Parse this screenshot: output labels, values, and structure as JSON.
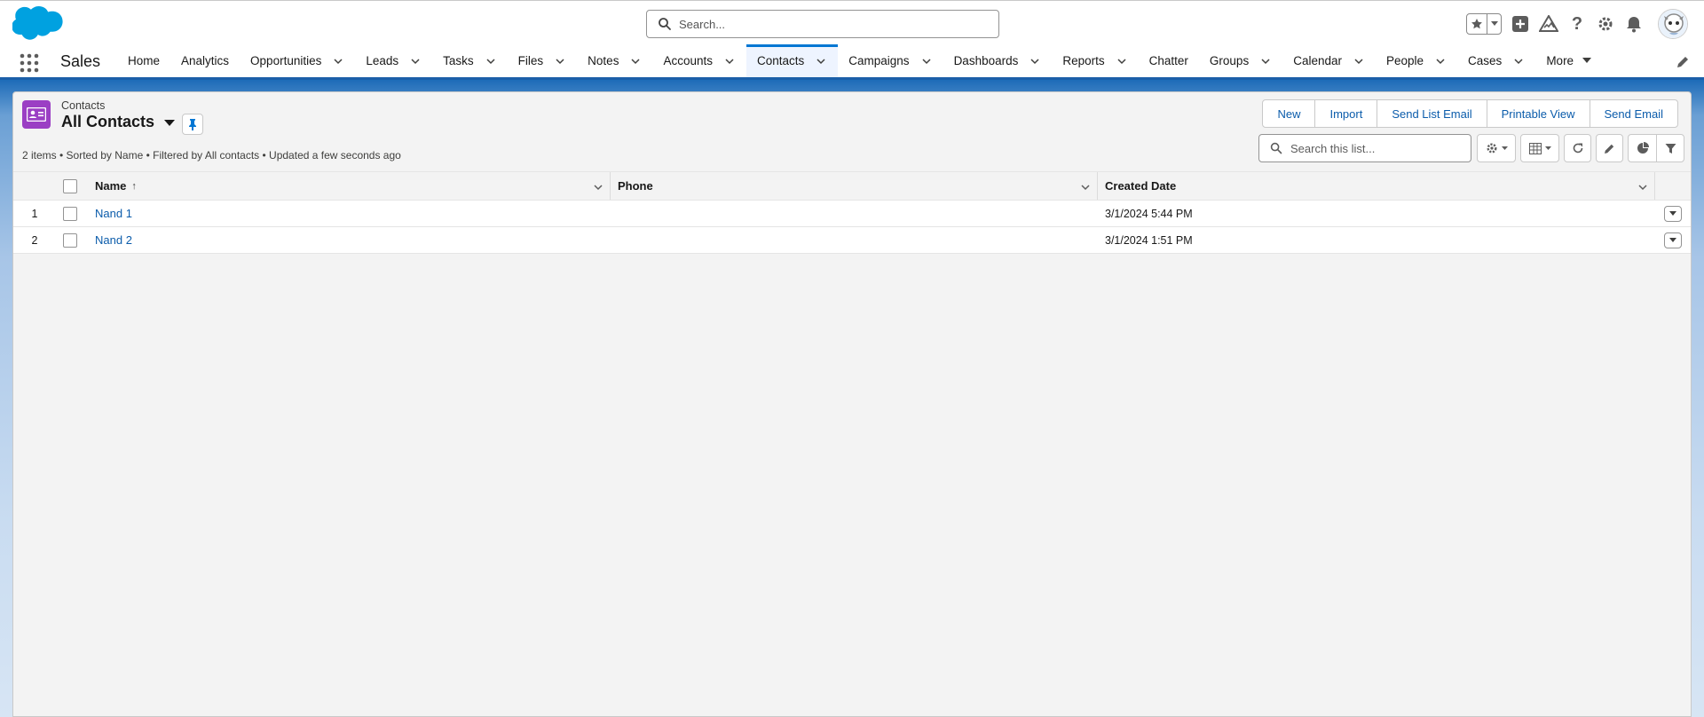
{
  "header": {
    "search_placeholder": "Search..."
  },
  "nav": {
    "app_name": "Sales",
    "tabs": [
      {
        "label": "Home",
        "dropdown": false
      },
      {
        "label": "Analytics",
        "dropdown": false
      },
      {
        "label": "Opportunities",
        "dropdown": true
      },
      {
        "label": "Leads",
        "dropdown": true
      },
      {
        "label": "Tasks",
        "dropdown": true
      },
      {
        "label": "Files",
        "dropdown": true
      },
      {
        "label": "Notes",
        "dropdown": true
      },
      {
        "label": "Accounts",
        "dropdown": true
      },
      {
        "label": "Contacts",
        "dropdown": true,
        "active": true
      },
      {
        "label": "Campaigns",
        "dropdown": true
      },
      {
        "label": "Dashboards",
        "dropdown": true
      },
      {
        "label": "Reports",
        "dropdown": true
      },
      {
        "label": "Chatter",
        "dropdown": false
      },
      {
        "label": "Groups",
        "dropdown": true
      },
      {
        "label": "Calendar",
        "dropdown": true
      },
      {
        "label": "People",
        "dropdown": true
      },
      {
        "label": "Cases",
        "dropdown": true
      }
    ],
    "more_label": "More"
  },
  "list": {
    "object_label": "Contacts",
    "view_name": "All Contacts",
    "status": "2 items • Sorted by Name • Filtered by All contacts • Updated a few seconds ago",
    "buttons": {
      "new": "New",
      "import": "Import",
      "send_list_email": "Send List Email",
      "printable_view": "Printable View",
      "send_email": "Send Email"
    },
    "search_placeholder": "Search this list...",
    "columns": {
      "name": "Name",
      "name_sort": "↑",
      "phone": "Phone",
      "created_date": "Created Date"
    },
    "rows": [
      {
        "num": "1",
        "name": "Nand 1",
        "phone": "",
        "created": "3/1/2024 5:44 PM"
      },
      {
        "num": "2",
        "name": "Nand 2",
        "phone": "",
        "created": "3/1/2024 1:51 PM"
      }
    ]
  },
  "colors": {
    "brand_blue": "#0176d3",
    "link": "#0b5cab",
    "contact_icon": "#9b3fc4"
  },
  "icons": {
    "logo": "salesforce-cloud-logo",
    "search": "search-icon",
    "favorites": "star-icon",
    "add": "plus-icon",
    "trailhead": "trailhead-icon",
    "help": "question-icon",
    "setup": "gear-icon",
    "notifications": "bell-icon",
    "avatar": "astro-avatar"
  }
}
